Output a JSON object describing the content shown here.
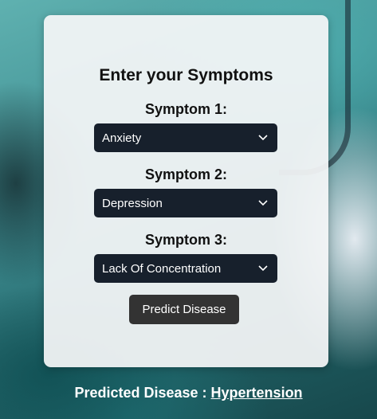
{
  "form": {
    "title": "Enter your Symptoms",
    "symptoms": [
      {
        "label": "Symptom 1:",
        "value": "Anxiety"
      },
      {
        "label": "Symptom 2:",
        "value": "Depression"
      },
      {
        "label": "Symptom 3:",
        "value": "Lack Of Concentration"
      }
    ],
    "predict_label": "Predict Disease"
  },
  "result": {
    "label": "Predicted Disease : ",
    "value": "Hypertension"
  },
  "colors": {
    "select_bg": "#17202c",
    "button_bg": "#333333",
    "card_bg": "#f5f6f8"
  },
  "icons": {
    "dropdown": "chevron-down-icon"
  }
}
